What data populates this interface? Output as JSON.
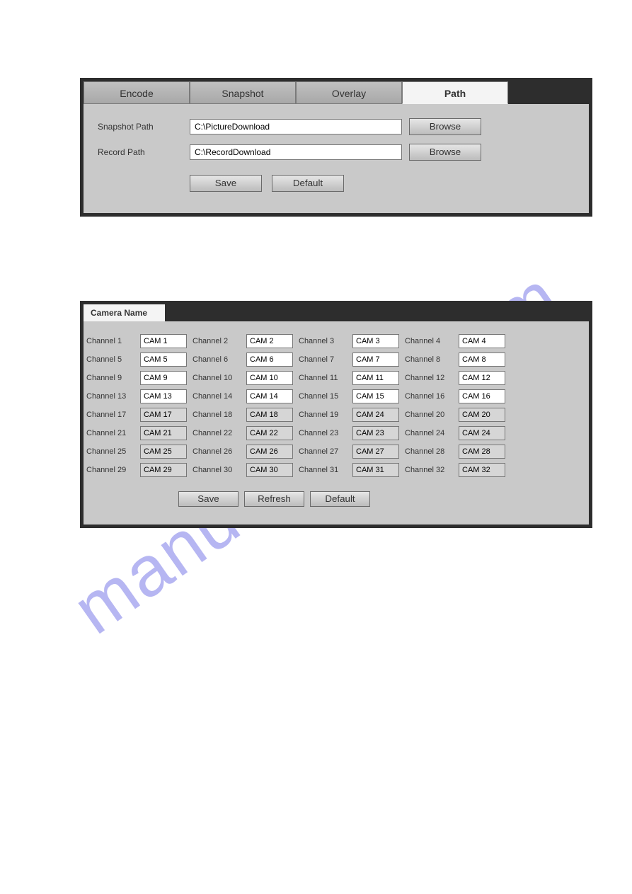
{
  "watermark": "manualshive.com",
  "panel1": {
    "tabs": [
      "Encode",
      "Snapshot",
      "Overlay",
      "Path"
    ],
    "active_tab": 3,
    "snapshot_label": "Snapshot Path",
    "snapshot_value": "C:\\PictureDownload",
    "record_label": "Record Path",
    "record_value": "C:\\RecordDownload",
    "browse_label": "Browse",
    "save_label": "Save",
    "default_label": "Default"
  },
  "panel2": {
    "tab_label": "Camera Name",
    "channels": [
      {
        "label": "Channel 1",
        "value": "CAM 1",
        "disabled": false
      },
      {
        "label": "Channel 2",
        "value": "CAM 2",
        "disabled": false
      },
      {
        "label": "Channel 3",
        "value": "CAM 3",
        "disabled": false
      },
      {
        "label": "Channel 4",
        "value": "CAM 4",
        "disabled": false
      },
      {
        "label": "Channel 5",
        "value": "CAM 5",
        "disabled": false
      },
      {
        "label": "Channel 6",
        "value": "CAM 6",
        "disabled": false
      },
      {
        "label": "Channel 7",
        "value": "CAM 7",
        "disabled": false
      },
      {
        "label": "Channel 8",
        "value": "CAM 8",
        "disabled": false
      },
      {
        "label": "Channel 9",
        "value": "CAM 9",
        "disabled": false
      },
      {
        "label": "Channel 10",
        "value": "CAM 10",
        "disabled": false
      },
      {
        "label": "Channel 11",
        "value": "CAM 11",
        "disabled": false
      },
      {
        "label": "Channel 12",
        "value": "CAM 12",
        "disabled": false
      },
      {
        "label": "Channel 13",
        "value": "CAM 13",
        "disabled": false
      },
      {
        "label": "Channel 14",
        "value": "CAM 14",
        "disabled": false
      },
      {
        "label": "Channel 15",
        "value": "CAM 15",
        "disabled": false
      },
      {
        "label": "Channel 16",
        "value": "CAM 16",
        "disabled": false
      },
      {
        "label": "Channel 17",
        "value": "CAM 17",
        "disabled": true
      },
      {
        "label": "Channel 18",
        "value": "CAM 18",
        "disabled": true
      },
      {
        "label": "Channel 19",
        "value": "CAM 24",
        "disabled": true
      },
      {
        "label": "Channel 20",
        "value": "CAM 20",
        "disabled": true
      },
      {
        "label": "Channel 21",
        "value": "CAM 21",
        "disabled": true
      },
      {
        "label": "Channel 22",
        "value": "CAM 22",
        "disabled": true
      },
      {
        "label": "Channel 23",
        "value": "CAM 23",
        "disabled": true
      },
      {
        "label": "Channel 24",
        "value": "CAM 24",
        "disabled": true
      },
      {
        "label": "Channel 25",
        "value": "CAM 25",
        "disabled": true
      },
      {
        "label": "Channel 26",
        "value": "CAM 26",
        "disabled": true
      },
      {
        "label": "Channel 27",
        "value": "CAM 27",
        "disabled": true
      },
      {
        "label": "Channel 28",
        "value": "CAM 28",
        "disabled": true
      },
      {
        "label": "Channel 29",
        "value": "CAM 29",
        "disabled": true
      },
      {
        "label": "Channel 30",
        "value": "CAM 30",
        "disabled": true
      },
      {
        "label": "Channel 31",
        "value": "CAM 31",
        "disabled": true
      },
      {
        "label": "Channel 32",
        "value": "CAM 32",
        "disabled": true
      }
    ],
    "save_label": "Save",
    "refresh_label": "Refresh",
    "default_label": "Default"
  }
}
